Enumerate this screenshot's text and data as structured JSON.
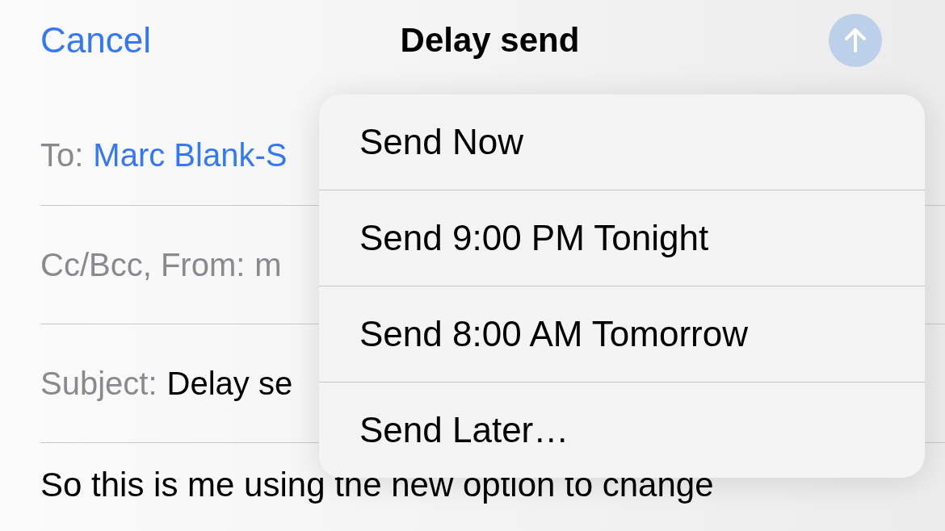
{
  "nav": {
    "cancel": "Cancel",
    "title": "Delay send",
    "send_button": {
      "disabled": true
    }
  },
  "fields": [
    {
      "label": "To:",
      "value": "Marc Blank-S",
      "kind": "recipient"
    },
    {
      "label": "Cc/Bcc, From:",
      "value": "m",
      "kind": "plain"
    },
    {
      "label": "Subject:",
      "value": "Delay se",
      "kind": "text"
    }
  ],
  "body": "So this is me using the new option to change",
  "menu": {
    "items": [
      {
        "label": "Send Now"
      },
      {
        "label": "Send 9:00 PM Tonight"
      },
      {
        "label": "Send 8:00 AM Tomorrow"
      },
      {
        "label": "Send Later…"
      }
    ]
  }
}
